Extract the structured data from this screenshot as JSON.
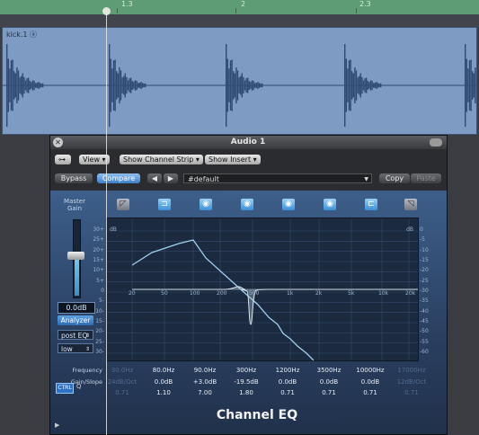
{
  "timeline": {
    "ruler_marks": [
      "1.3",
      "2",
      "2.3"
    ],
    "region_name": "kick.1 ⓐ",
    "waveform_color": "#2f4a73",
    "region_color": "#7d9bc3"
  },
  "plugin": {
    "title": "Audio 1",
    "header": {
      "link_icon": "link-icon",
      "view_label": "View ▾",
      "show_channel_strip": "Show Channel Strip ▾",
      "show_insert": "Show Insert ▾",
      "bypass_label": "Bypass",
      "compare_label": "Compare",
      "prev_label": "◀",
      "next_label": "▶",
      "preset_value": "#default",
      "copy_label": "Copy",
      "paste_label": "Paste"
    },
    "master_gain_label": "Master\nGain",
    "master_gain_value": "0.0dB",
    "analyzer_label": "Analyzer",
    "analyzer_mode": "post EQ",
    "analyzer_resolution": "low",
    "bands": [
      {
        "icon": "low-cut-icon",
        "enabled": false
      },
      {
        "icon": "low-shelf-icon",
        "enabled": true
      },
      {
        "icon": "bell-icon",
        "enabled": true
      },
      {
        "icon": "bell-icon",
        "enabled": true
      },
      {
        "icon": "bell-icon",
        "enabled": true
      },
      {
        "icon": "bell-icon",
        "enabled": true
      },
      {
        "icon": "high-shelf-icon",
        "enabled": true
      },
      {
        "icon": "high-cut-icon",
        "enabled": false
      }
    ],
    "graph": {
      "left_axis_top": "dB",
      "right_axis_top": "dB",
      "left_ticks": [
        "+30",
        "+25",
        "+20",
        "+15",
        "+10",
        "+5",
        "0",
        "-5",
        "-10",
        "-15",
        "-20",
        "-25",
        "-30"
      ],
      "right_ticks": [
        "0",
        "-5",
        "-10",
        "-15",
        "-20",
        "-25",
        "-30",
        "-35",
        "-40",
        "-45",
        "-50",
        "-55",
        "-60"
      ],
      "freq_ticks": [
        "20",
        "50",
        "100",
        "200",
        "500",
        "1k",
        "2k",
        "5k",
        "10k",
        "20k"
      ]
    },
    "param_labels": {
      "frequency": "Frequency",
      "gain_slope": "Gain/Slope",
      "q": "Q",
      "ctrl": "CTRL"
    },
    "params": {
      "frequency": [
        "30.0Hz",
        "80.0Hz",
        "90.0Hz",
        "300Hz",
        "1200Hz",
        "3500Hz",
        "10000Hz",
        "17000Hz"
      ],
      "gain": [
        "24dB/Oct",
        "0.0dB",
        "+3.0dB",
        "-19.5dB",
        "0.0dB",
        "0.0dB",
        "0.0dB",
        "12dB/Oct"
      ],
      "q": [
        "0.71",
        "1.10",
        "7.00",
        "1.80",
        "0.71",
        "0.71",
        "0.71",
        "0.71"
      ],
      "enabled": [
        false,
        true,
        true,
        true,
        true,
        true,
        true,
        false
      ]
    },
    "plugin_name": "Channel EQ",
    "accent_color": "#3c8fd6"
  }
}
